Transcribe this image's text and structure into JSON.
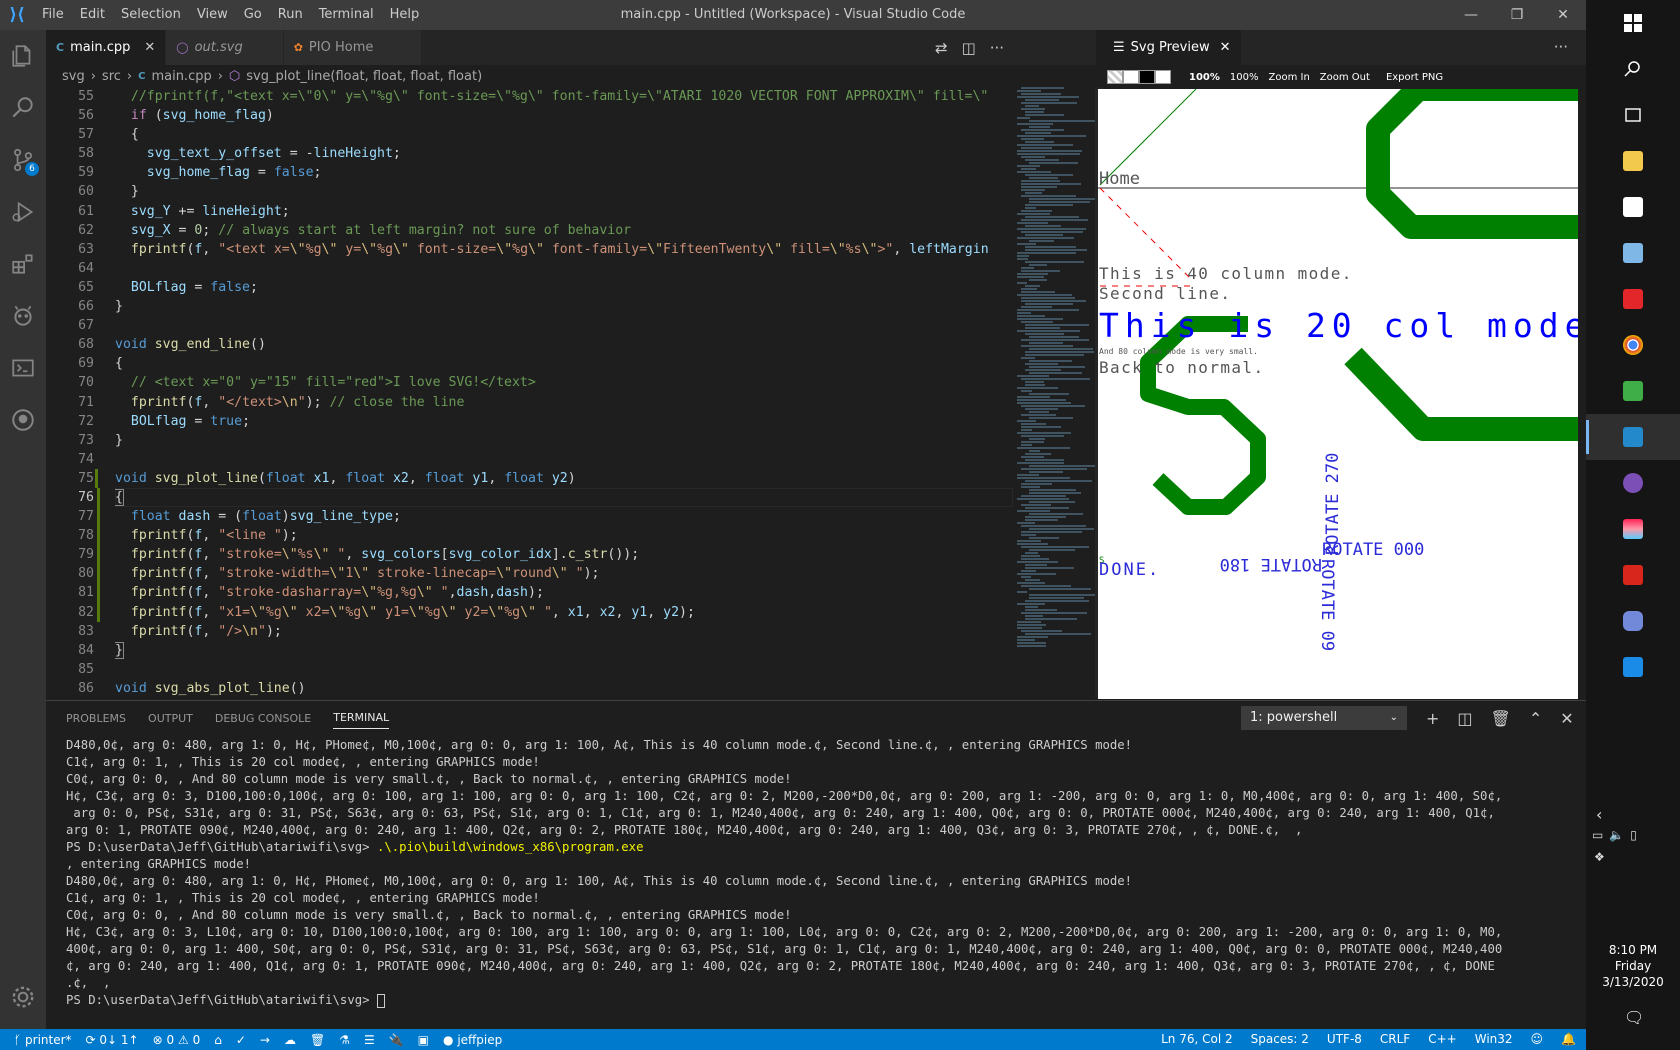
{
  "window": {
    "title": "main.cpp - Untitled (Workspace) - Visual Studio Code"
  },
  "menu": [
    "File",
    "Edit",
    "Selection",
    "View",
    "Go",
    "Run",
    "Terminal",
    "Help"
  ],
  "activity": {
    "scm_badge": "6"
  },
  "tabs": [
    {
      "label": "main.cpp",
      "icon": "C"
    },
    {
      "label": "out.svg",
      "icon": "◯"
    },
    {
      "label": "PIO Home",
      "icon": "✿"
    }
  ],
  "breadcrumb": [
    "svg",
    "src",
    "main.cpp",
    "svg_plot_line(float, float, float, float)"
  ],
  "line_numbers": [
    "55",
    "56",
    "57",
    "58",
    "59",
    "60",
    "61",
    "62",
    "63",
    "64",
    "65",
    "66",
    "67",
    "68",
    "69",
    "70",
    "71",
    "72",
    "73",
    "74",
    "75",
    "76",
    "77",
    "78",
    "79",
    "80",
    "81",
    "82",
    "83",
    "84",
    "85",
    "86"
  ],
  "code_lines_plain": [
    "//fprintf(f,\"<text x=\\\"0\\\" y=\\\"%g\\\" font-size=\\\"%g\\\" font-family=\\\"ATARI 1020 VECTOR FONT APPROXIM\\\" fill=\\\"",
    "if (svg_home_flag)",
    "{",
    "svg_text_y_offset = -lineHeight;",
    "svg_home_flag = false;",
    "}",
    "svg_Y += lineHeight;",
    "svg_X = 0; // always start at left margin? not sure of behavior",
    "fprintf(f, \"<text x=\\\"%g\\\" y=\\\"%g\\\" font-size=\\\"%g\\\" font-family=\\\"FifteenTwenty\\\" fill=\\\"%s\\\">\", leftMargin",
    "",
    "BOLflag = false;",
    "}",
    "",
    "void svg_end_line()",
    "{",
    "// <text x=\"0\" y=\"15\" fill=\"red\">I love SVG!</text>",
    "fprintf(f, \"</text>\\n\"); // close the line",
    "BOLflag = true;",
    "}",
    "",
    "void svg_plot_line(float x1, float x2, float y1, float y2)",
    "{",
    "float dash = (float)svg_line_type;",
    "fprintf(f, \"<line \");",
    "fprintf(f, \"stroke=\\\"%s\\\" \", svg_colors[svg_color_idx].c_str());",
    "fprintf(f, \"stroke-width=\\\"1\\\" stroke-linecap=\\\"round\\\" \");",
    "fprintf(f, \"stroke-dasharray=\\\"%g,%g\\\" \",dash,dash);",
    "fprintf(f, \"x1=\\\"%g\\\" x2=\\\"%g\\\" y1=\\\"%g\\\" y2=\\\"%g\\\" \", x1, x2, y1, y2);",
    "fprintf(f, \"/>\\n\");",
    "}",
    "",
    "void svg_abs_plot_line()"
  ],
  "preview": {
    "tab": "Svg Preview",
    "zoom_value": "100%",
    "zoom_pct": "100%",
    "zoom_in": "Zoom In",
    "zoom_out": "Zoom Out",
    "export": "Export PNG",
    "texts": {
      "home": "Home",
      "line40": "This is 40 column mode.",
      "second": "Second line.",
      "col20": "This is 20 col mode",
      "col80": "And 80 column mode is very small.",
      "normal": "Back to normal.",
      "rot270": "ROTATE 270",
      "rot000": "ROTATE 000",
      "rot180": "ROTATE 180",
      "rot090": "ROTATE 09",
      "done": "DONE.",
      "small_s": "S"
    }
  },
  "panel": {
    "tabs": [
      "PROBLEMS",
      "OUTPUT",
      "DEBUG CONSOLE",
      "TERMINAL"
    ],
    "terminal_select": "1: powershell",
    "lines": [
      "D480,0¢, arg 0: 480, arg 1: 0, H¢, PHome¢, M0,100¢, arg 0: 0, arg 1: 100, A¢, This is 40 column mode.¢, Second line.¢, , entering GRAPHICS mode!",
      "C1¢, arg 0: 1, , This is 20 col mode¢, , entering GRAPHICS mode!",
      "C0¢, arg 0: 0, , And 80 column mode is very small.¢, , Back to normal.¢, , entering GRAPHICS mode!",
      "H¢, C3¢, arg 0: 3, D100,100:0,100¢, arg 0: 100, arg 1: 100, arg 0: 0, arg 1: 100, C2¢, arg 0: 2, M200,-200*D0,0¢, arg 0: 200, arg 1: -200, arg 0: 0, arg 1: 0, M0,400¢, arg 0: 0, arg 1: 400, S0¢,",
      " arg 0: 0, PS¢, S31¢, arg 0: 31, PS¢, S63¢, arg 0: 63, PS¢, S1¢, arg 0: 1, C1¢, arg 0: 1, M240,400¢, arg 0: 240, arg 1: 400, Q0¢, arg 0: 0, PROTATE 000¢, M240,400¢, arg 0: 240, arg 1: 400, Q1¢,",
      "arg 0: 1, PROTATE 090¢, M240,400¢, arg 0: 240, arg 1: 400, Q2¢, arg 0: 2, PROTATE 180¢, M240,400¢, arg 0: 240, arg 1: 400, Q3¢, arg 0: 3, PROTATE 270¢, , ¢, DONE.¢,  ,",
      "PS D:\\userData\\Jeff\\GitHub\\atariwifi\\svg> .\\.pio\\build\\windows_x86\\program.exe",
      ", entering GRAPHICS mode!",
      "D480,0¢, arg 0: 480, arg 1: 0, H¢, PHome¢, M0,100¢, arg 0: 0, arg 1: 100, A¢, This is 40 column mode.¢, Second line.¢, , entering GRAPHICS mode!",
      "C1¢, arg 0: 1, , This is 20 col mode¢, , entering GRAPHICS mode!",
      "C0¢, arg 0: 0, , And 80 column mode is very small.¢, , Back to normal.¢, , entering GRAPHICS mode!",
      "H¢, C3¢, arg 0: 3, L10¢, arg 0: 10, D100,100:0,100¢, arg 0: 100, arg 1: 100, arg 0: 0, arg 1: 100, L0¢, arg 0: 0, C2¢, arg 0: 2, M200,-200*D0,0¢, arg 0: 200, arg 1: -200, arg 0: 0, arg 1: 0, M0,",
      "400¢, arg 0: 0, arg 1: 400, S0¢, arg 0: 0, PS¢, S31¢, arg 0: 31, PS¢, S63¢, arg 0: 63, PS¢, S1¢, arg 0: 1, C1¢, arg 0: 1, M240,400¢, arg 0: 240, arg 1: 400, Q0¢, arg 0: 0, PROTATE 000¢, M240,400",
      "¢, arg 0: 240, arg 1: 400, Q1¢, arg 0: 1, PROTATE 090¢, M240,400¢, arg 0: 240, arg 1: 400, Q2¢, arg 0: 2, PROTATE 180¢, M240,400¢, arg 0: 240, arg 1: 400, Q3¢, arg 0: 3, PROTATE 270¢, , ¢, DONE",
      ".¢,  ,"
    ],
    "cmd_prompt": "PS D:\\userData\\Jeff\\GitHub\\atariwifi\\svg> ",
    "cmd_text": ".\\.pio\\build\\windows_x86\\program.exe",
    "prompt": "PS D:\\userData\\Jeff\\GitHub\\atariwifi\\svg> "
  },
  "status": {
    "branch": "printer*",
    "sync": "0↓ 1↑",
    "errors": "0",
    "warnings": "0",
    "user": "jeffpiep",
    "position": "Ln 76, Col 2",
    "spaces": "Spaces: 2",
    "encoding": "UTF-8",
    "eol": "CRLF",
    "language": "C++",
    "platform": "Win32"
  },
  "taskbar": {
    "time": "8:10 PM",
    "day": "Friday",
    "date": "3/13/2020"
  },
  "colors": {
    "accent": "#007acc",
    "plot_green": "#008000",
    "plot_blue": "#0000ff"
  }
}
